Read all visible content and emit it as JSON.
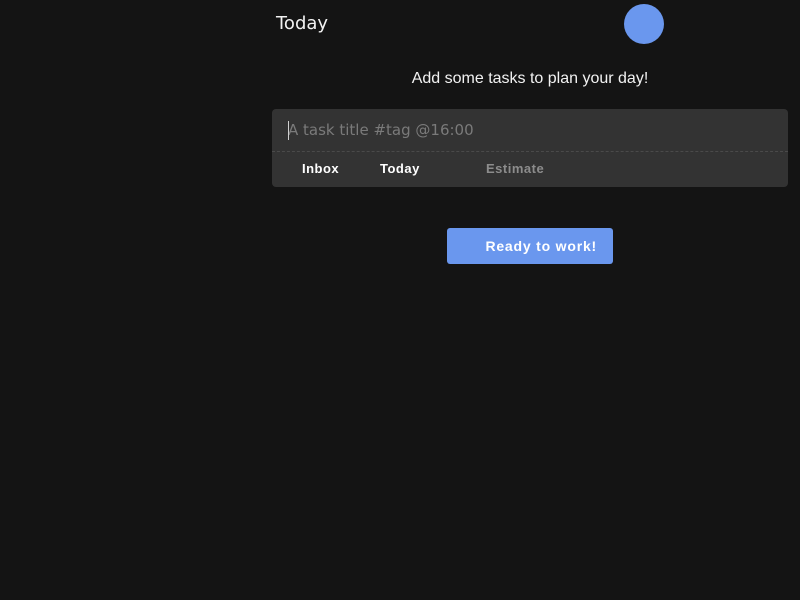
{
  "header": {
    "title": "Today"
  },
  "main": {
    "prompt": "Add some tasks to plan your day!",
    "task_input": {
      "placeholder": "A task title #tag @16:00",
      "value": ""
    },
    "task_options": {
      "inbox_label": "Inbox",
      "today_label": "Today",
      "estimate_label": "Estimate"
    },
    "ready_button_label": "Ready to work!"
  },
  "colors": {
    "background": "#141414",
    "accent": "#6a97ee",
    "panel": "#333333"
  }
}
